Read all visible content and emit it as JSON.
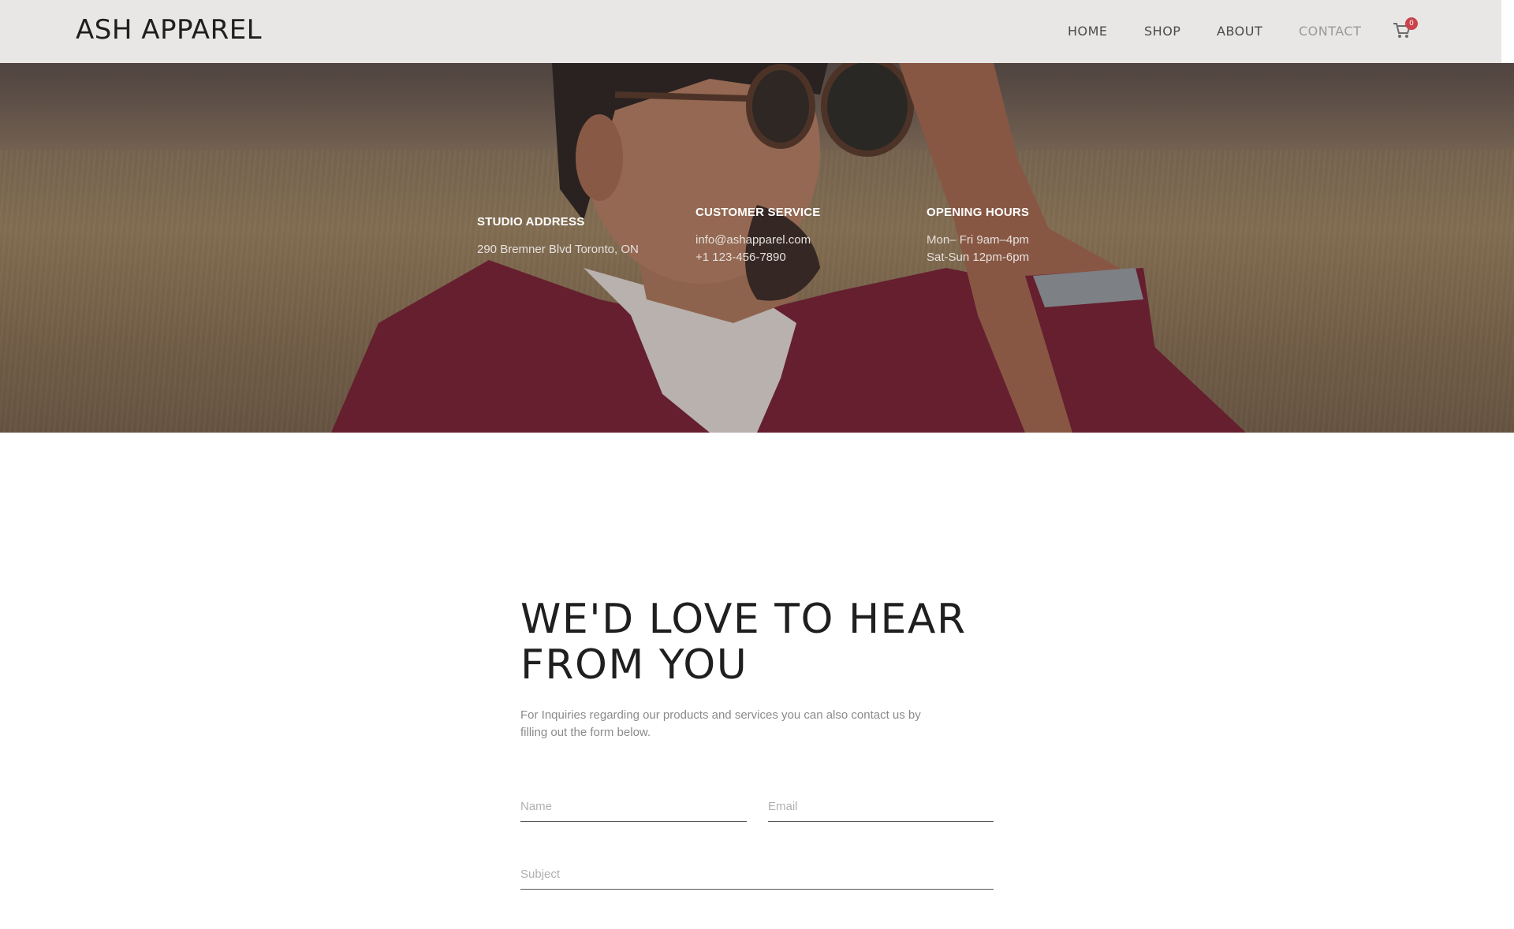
{
  "header": {
    "brand": "ASH APPAREL",
    "nav": [
      "HOME",
      "SHOP",
      "ABOUT",
      "CONTACT"
    ],
    "active_nav": "CONTACT",
    "cart_count": "0",
    "cart_icon": "shopping-cart-icon"
  },
  "hero": {
    "studio": {
      "title": "STUDIO ADDRESS",
      "lines": [
        "290 Bremner Blvd Toronto, ON"
      ]
    },
    "service": {
      "title": "CUSTOMER SERVICE",
      "lines": [
        "info@ashapparel.com",
        "+1 123-456-7890"
      ]
    },
    "hours": {
      "title": "OPENING HOURS",
      "lines": [
        "Mon– Fri 9am–4pm",
        "Sat-Sun 12pm-6pm"
      ]
    }
  },
  "contact": {
    "headline_line1": "WE'D LOVE TO HEAR",
    "headline_line2": "FROM YOU",
    "intro_line1": "For Inquiries regarding our products and services you can also contact us by",
    "intro_line2": "filling out the form below.",
    "form": {
      "name_placeholder": "Name",
      "email_placeholder": "Email",
      "subject_placeholder": "Subject"
    }
  },
  "colors": {
    "header_bg": "#e8e7e5",
    "cart_badge": "#c9434b",
    "slider_arrow": "#2e8b6e"
  }
}
